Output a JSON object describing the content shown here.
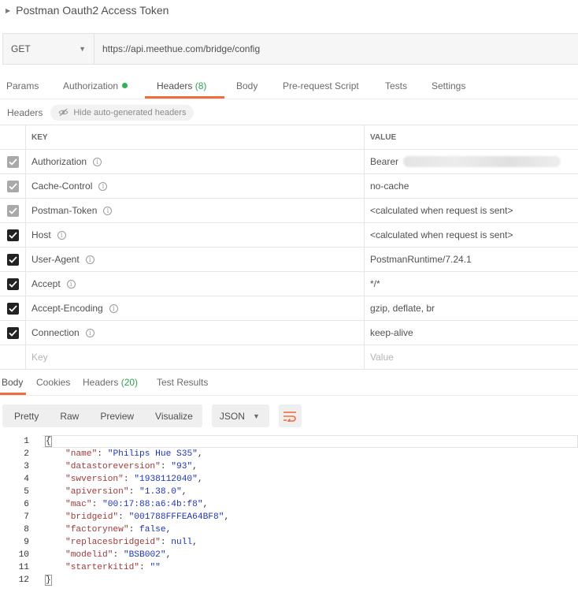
{
  "request": {
    "title": "Postman Oauth2 Access Token",
    "method": "GET",
    "url": "https://api.meethue.com/bridge/config"
  },
  "request_tabs": [
    {
      "label": "Params"
    },
    {
      "label": "Authorization"
    },
    {
      "label": "Headers",
      "count": "(8)"
    },
    {
      "label": "Body"
    },
    {
      "label": "Pre-request Script"
    },
    {
      "label": "Tests"
    },
    {
      "label": "Settings"
    }
  ],
  "headers_section": {
    "label": "Headers",
    "hide_button": "Hide auto-generated headers"
  },
  "headers_table": {
    "columns": {
      "key": "KEY",
      "value": "VALUE"
    },
    "rows": [
      {
        "key": "Authorization",
        "value": "Bearer",
        "checked": true,
        "auto": true
      },
      {
        "key": "Cache-Control",
        "value": "no-cache",
        "checked": true,
        "auto": true
      },
      {
        "key": "Postman-Token",
        "value": "<calculated when request is sent>",
        "checked": true,
        "auto": true
      },
      {
        "key": "Host",
        "value": "<calculated when request is sent>",
        "checked": true,
        "auto": false
      },
      {
        "key": "User-Agent",
        "value": "PostmanRuntime/7.24.1",
        "checked": true,
        "auto": false
      },
      {
        "key": "Accept",
        "value": "*/*",
        "checked": true,
        "auto": false
      },
      {
        "key": "Accept-Encoding",
        "value": "gzip, deflate, br",
        "checked": true,
        "auto": false
      },
      {
        "key": "Connection",
        "value": "keep-alive",
        "checked": true,
        "auto": false
      }
    ],
    "new_row": {
      "key_placeholder": "Key",
      "value_placeholder": "Value"
    }
  },
  "response_tabs": [
    {
      "label": "Body"
    },
    {
      "label": "Cookies"
    },
    {
      "label": "Headers",
      "count": "(20)"
    },
    {
      "label": "Test Results"
    }
  ],
  "view_modes": [
    "Pretty",
    "Raw",
    "Preview",
    "Visualize"
  ],
  "format": "JSON",
  "code_lines": [
    {
      "n": "1",
      "text": "{"
    },
    {
      "n": "2",
      "key": "\"name\"",
      "value": "\"Philips Hue S35\"",
      "type": "str"
    },
    {
      "n": "3",
      "key": "\"datastoreversion\"",
      "value": "\"93\"",
      "type": "str"
    },
    {
      "n": "4",
      "key": "\"swversion\"",
      "value": "\"1938112040\"",
      "type": "str"
    },
    {
      "n": "5",
      "key": "\"apiversion\"",
      "value": "\"1.38.0\"",
      "type": "str"
    },
    {
      "n": "6",
      "key": "\"mac\"",
      "value": "\"00:17:88:a6:4b:f8\"",
      "type": "str"
    },
    {
      "n": "7",
      "key": "\"bridgeid\"",
      "value": "\"001788FFFEA64BF8\"",
      "type": "str"
    },
    {
      "n": "8",
      "key": "\"factorynew\"",
      "value": "false",
      "type": "kw"
    },
    {
      "n": "9",
      "key": "\"replacesbridgeid\"",
      "value": "null",
      "type": "kw"
    },
    {
      "n": "10",
      "key": "\"modelid\"",
      "value": "\"BSB002\"",
      "type": "str"
    },
    {
      "n": "11",
      "key": "\"starterkitid\"",
      "value": "\"\"",
      "type": "str",
      "last": true
    },
    {
      "n": "12",
      "text": "}"
    }
  ],
  "colors": {
    "accent": "#f26b3a",
    "count_green": "#2e9f4e",
    "auth_dot": "#2db355",
    "json_key": "#9c3a3a",
    "json_value": "#1f35b3"
  }
}
